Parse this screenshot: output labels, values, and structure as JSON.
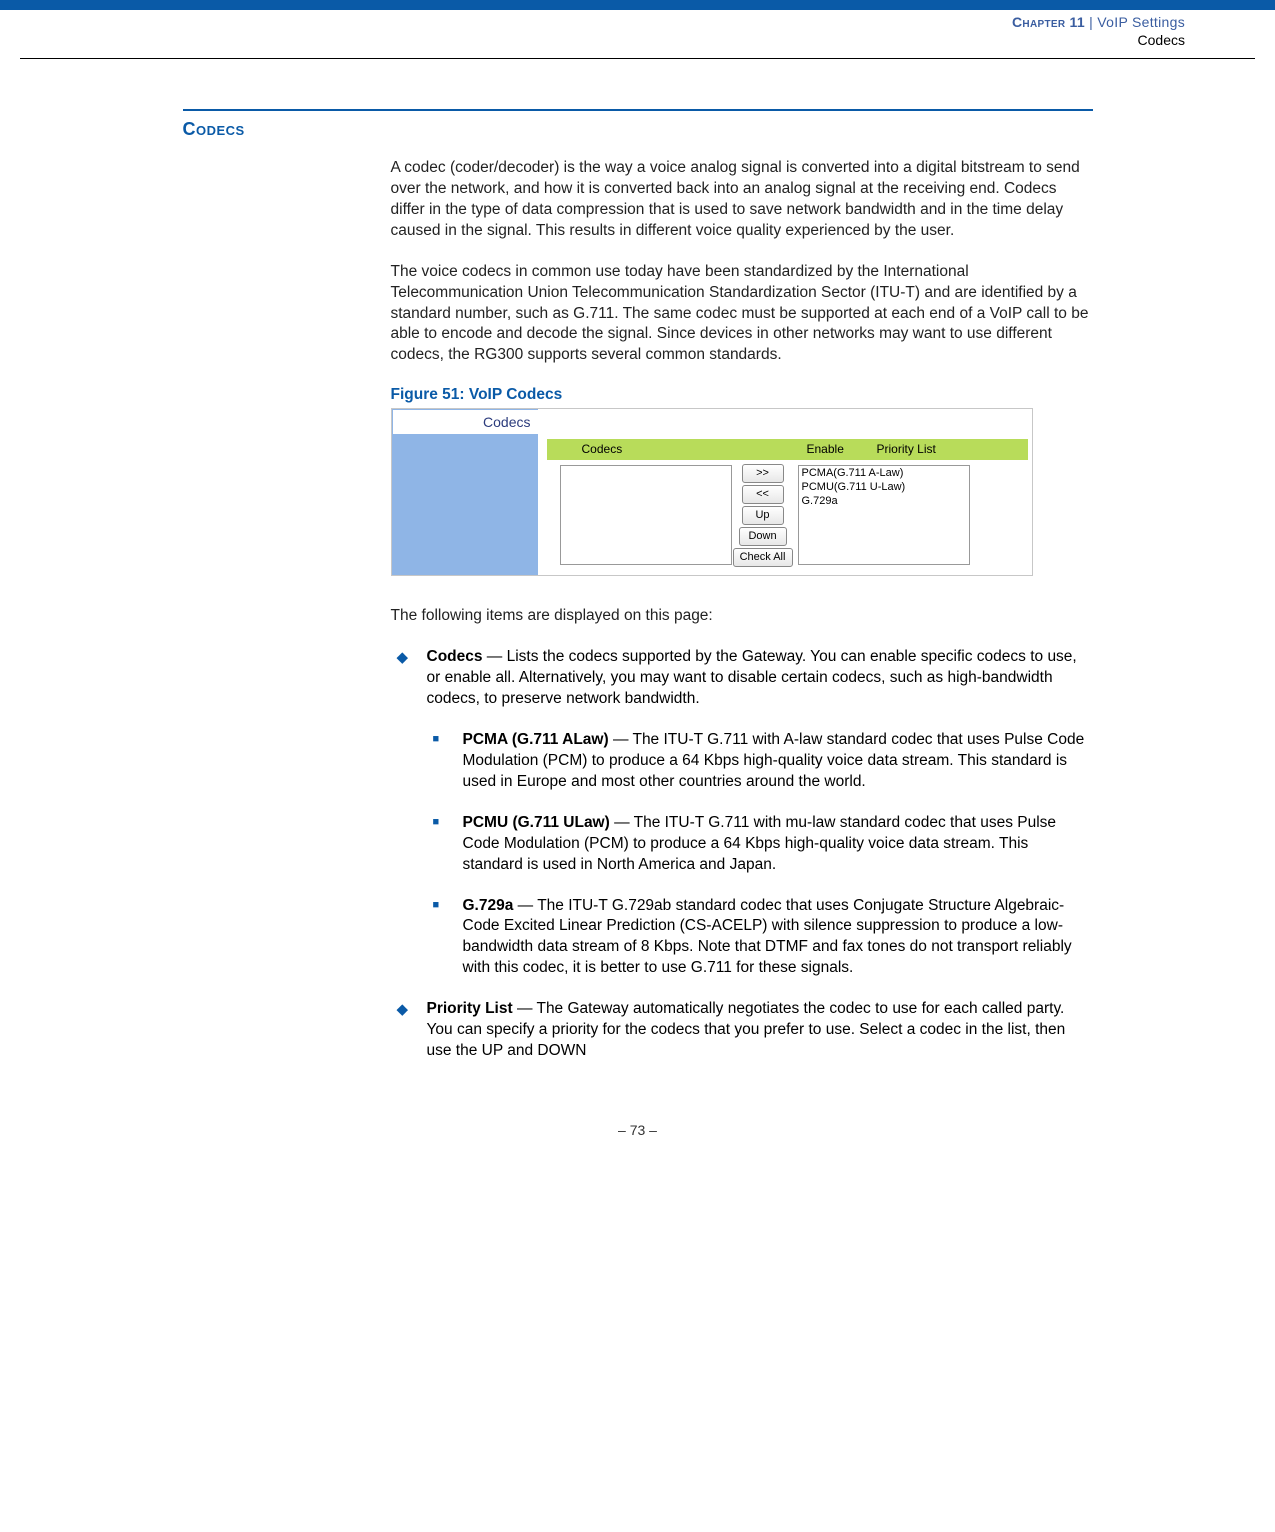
{
  "header": {
    "chapterWord": "Chapter",
    "chapterNum": "11",
    "sep": "  |  ",
    "settings": "VoIP Settings",
    "sub": "Codecs"
  },
  "title": "Codecs",
  "para1": "A codec (coder/decoder) is the way a voice analog signal is converted into a digital bitstream to send over the network, and how it is converted back into an analog signal at the receiving end. Codecs differ in the type of data compression that is used to save network bandwidth and in the time delay caused in the signal. This results in different voice quality experienced by the user.",
  "para2": "The voice codecs in common use today have been standardized by the International Telecommunication Union Telecommunication Standardization Sector (ITU‑T) and are identified by a standard number, such as G.711. The same codec must be supported at each end of a VoIP call to be able to encode and decode the signal. Since devices in other networks may want to use different codecs, the RG300 supports several common standards.",
  "figCaption": "Figure 51:  VoIP Codecs",
  "screenshot": {
    "tab": "Codecs",
    "colCodecs": "Codecs",
    "colEnable": "Enable",
    "colPriority": "Priority List",
    "btnRight": ">>",
    "btnLeft": "<<",
    "btnUp": "Up",
    "btnDown": "Down",
    "btnAll": "Check All",
    "pri1": "PCMA(G.711 A-Law)",
    "pri2": "PCMU(G.711 U-Law)",
    "pri3": "G.729a"
  },
  "para3": "The following items are displayed on this page:",
  "codecs": {
    "term": "Codecs",
    "text": " — Lists the codecs supported by the Gateway. You can enable specific codecs to use, or enable all. Alternatively, you may want to disable certain codecs, such as high-bandwidth codecs, to preserve network bandwidth."
  },
  "pcma": {
    "term": "PCMA (G.711 ALaw)",
    "text": " — The ITU-T G.711 with A-law standard codec that uses Pulse Code Modulation (PCM) to produce a 64 Kbps high-quality voice data stream. This standard is used in Europe and most other countries around the world."
  },
  "pcmu": {
    "term": "PCMU (G.711 ULaw)",
    "text": " — The ITU-T G.711 with mu-law standard codec that uses Pulse Code Modulation (PCM) to produce a 64 Kbps high-quality voice data stream. This standard is used in North America and Japan."
  },
  "g729": {
    "term": "G.729a",
    "text": " — The ITU-T G.729ab standard codec that uses Conjugate Structure Algebraic-Code Excited Linear Prediction (CS-ACELP) with silence suppression to produce a low-bandwidth data stream of 8 Kbps. Note that DTMF and fax tones do not transport reliably with this codec, it is better to use G.711 for these signals."
  },
  "priority": {
    "term": "Priority List",
    "text": " — The Gateway automatically negotiates the codec to use for each called party. You can specify a priority for the codecs that you prefer to use. Select a codec in the list, then use the UP and DOWN"
  },
  "pageNum": "–  73  –"
}
